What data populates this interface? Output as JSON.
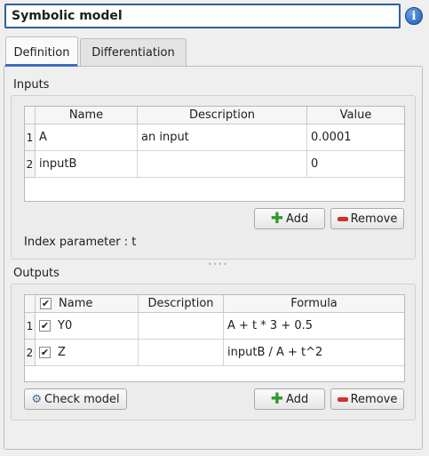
{
  "model_name": "Symbolic model",
  "info_icon": "info-icon",
  "tabs": [
    {
      "label": "Definition",
      "active": true
    },
    {
      "label": "Differentiation",
      "active": false
    }
  ],
  "inputs": {
    "group_title": "Inputs",
    "columns": [
      "Name",
      "Description",
      "Value"
    ],
    "rows": [
      {
        "index": "1",
        "name": "A",
        "description": "an input",
        "value": "0.0001"
      },
      {
        "index": "2",
        "name": "inputB",
        "description": "",
        "value": "0"
      }
    ],
    "add_label": "Add",
    "remove_label": "Remove",
    "index_parameter": "Index parameter : t"
  },
  "outputs": {
    "group_title": "Outputs",
    "columns": [
      "Name",
      "Description",
      "Formula"
    ],
    "header_checked": true,
    "rows": [
      {
        "index": "1",
        "checked": true,
        "name": "Y0",
        "description": "",
        "formula": "A + t * 3 + 0.5"
      },
      {
        "index": "2",
        "checked": true,
        "name": "Z",
        "description": "",
        "formula": "inputB / A + t^2"
      }
    ],
    "check_model_label": "Check model",
    "add_label": "Add",
    "remove_label": "Remove"
  },
  "colors": {
    "accent": "#3b6bbf",
    "add_icon": "#2e9a2e",
    "remove_icon": "#d2322d"
  }
}
